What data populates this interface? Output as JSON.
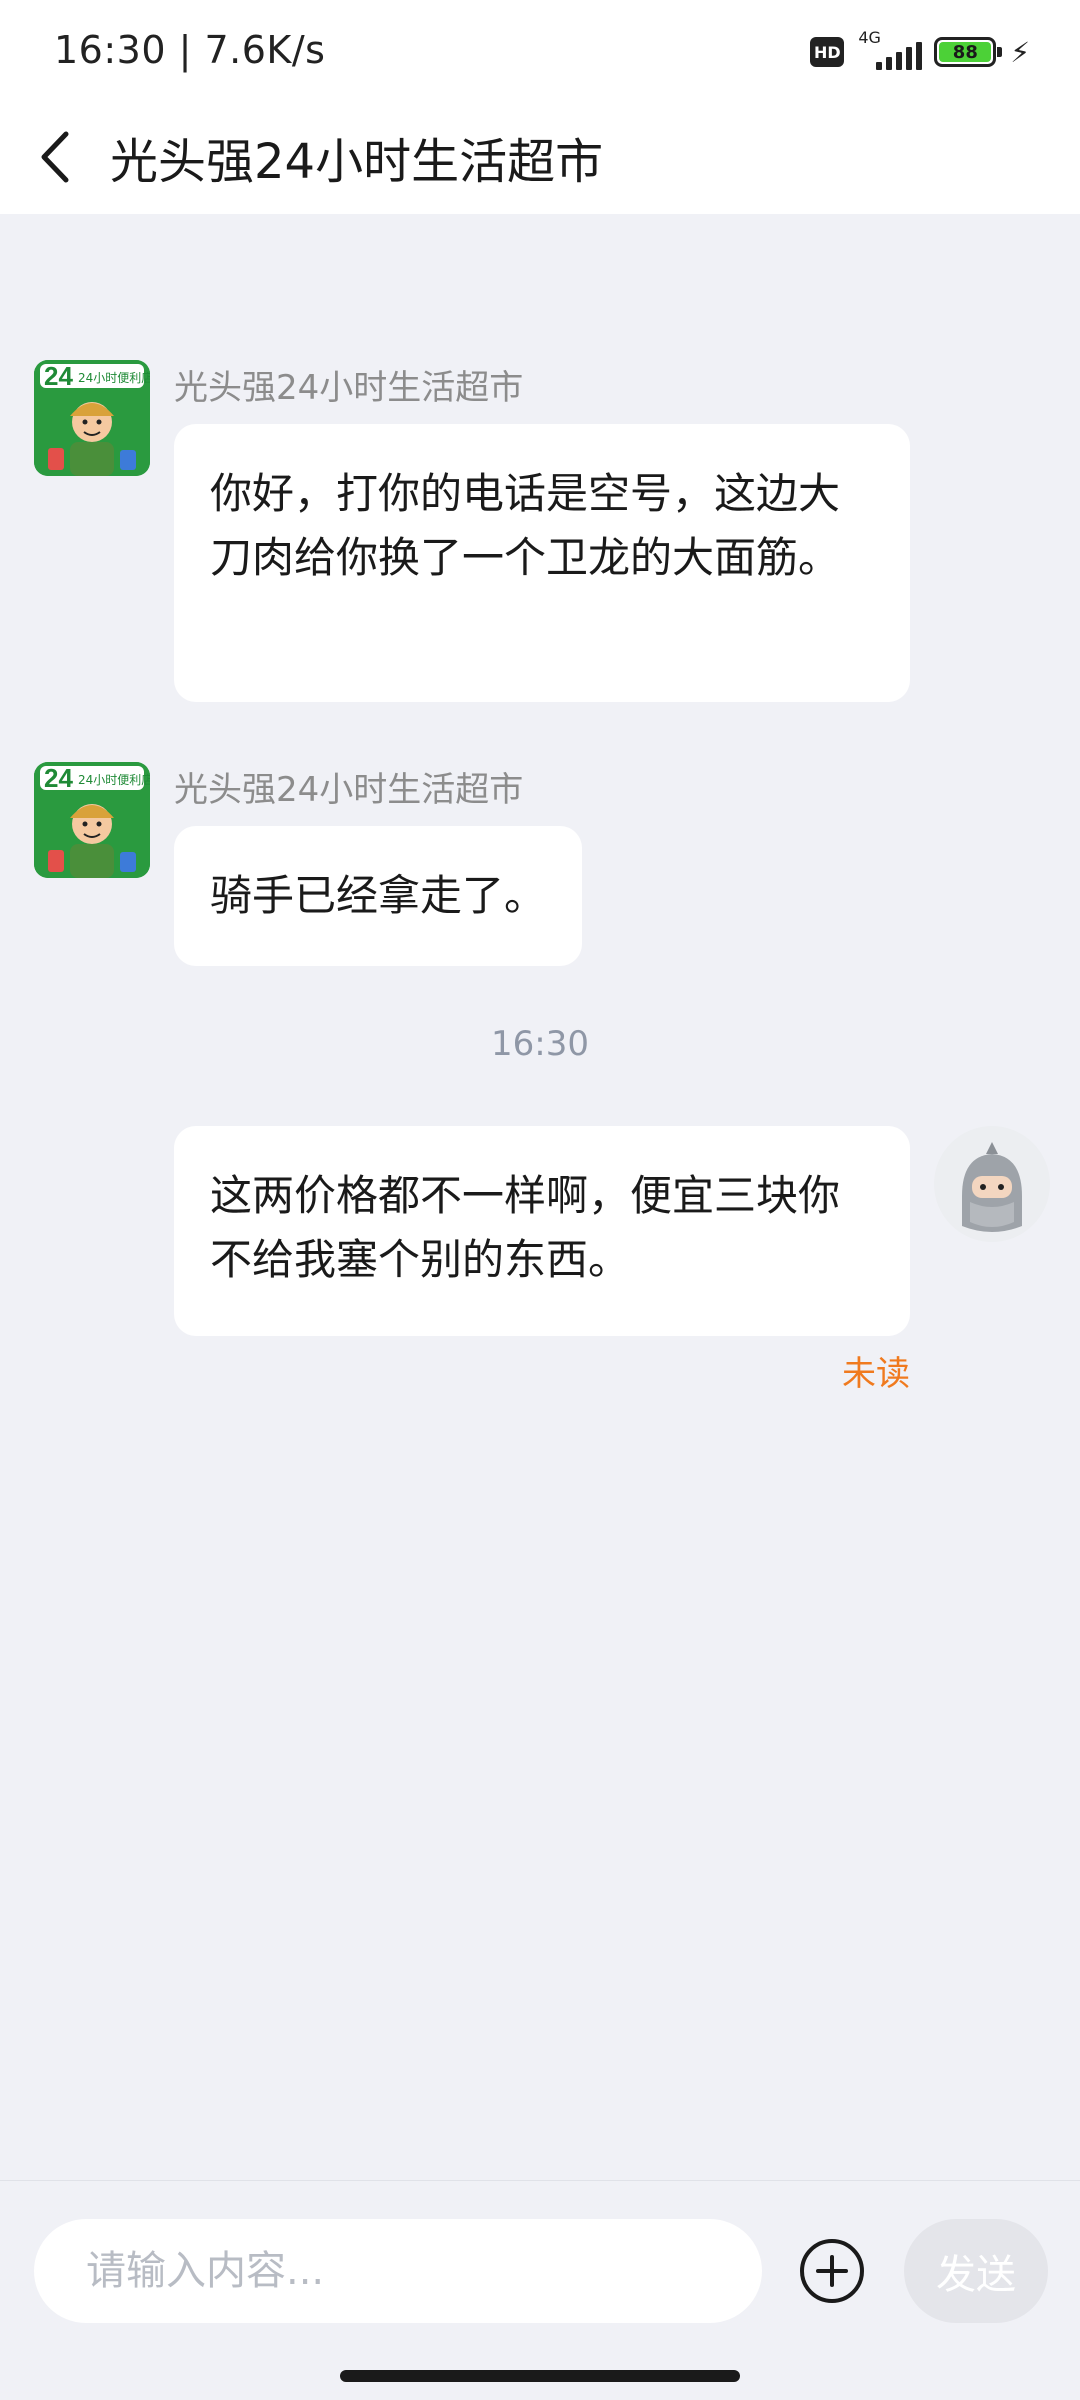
{
  "status_bar": {
    "time_speed": "16:30 | 7.6K/s",
    "hd": "HD",
    "network": "4G",
    "battery": "88"
  },
  "header": {
    "title": "光头强24小时生活超市"
  },
  "messages": [
    {
      "sender": "光头强24小时生活超市",
      "text": "你好，打你的电话是空号，这边大刀肉给你换了一个卫龙的大面筋。",
      "avatar_text": "24小时便利店"
    },
    {
      "sender": "光头强24小时生活超市",
      "text": "骑手已经拿走了。",
      "avatar_text": "24小时便利店"
    },
    {
      "timestamp": "16:30"
    },
    {
      "text": "这两价格都不一样啊，便宜三块你不给我塞个别的东西。",
      "status": "未读"
    }
  ],
  "input": {
    "placeholder": "请输入内容...",
    "send_label": "发送"
  },
  "colors": {
    "background": "#f0f1f6",
    "bubble": "#ffffff",
    "unread": "#f07a1e",
    "shop_avatar": "#2a9a3f"
  }
}
